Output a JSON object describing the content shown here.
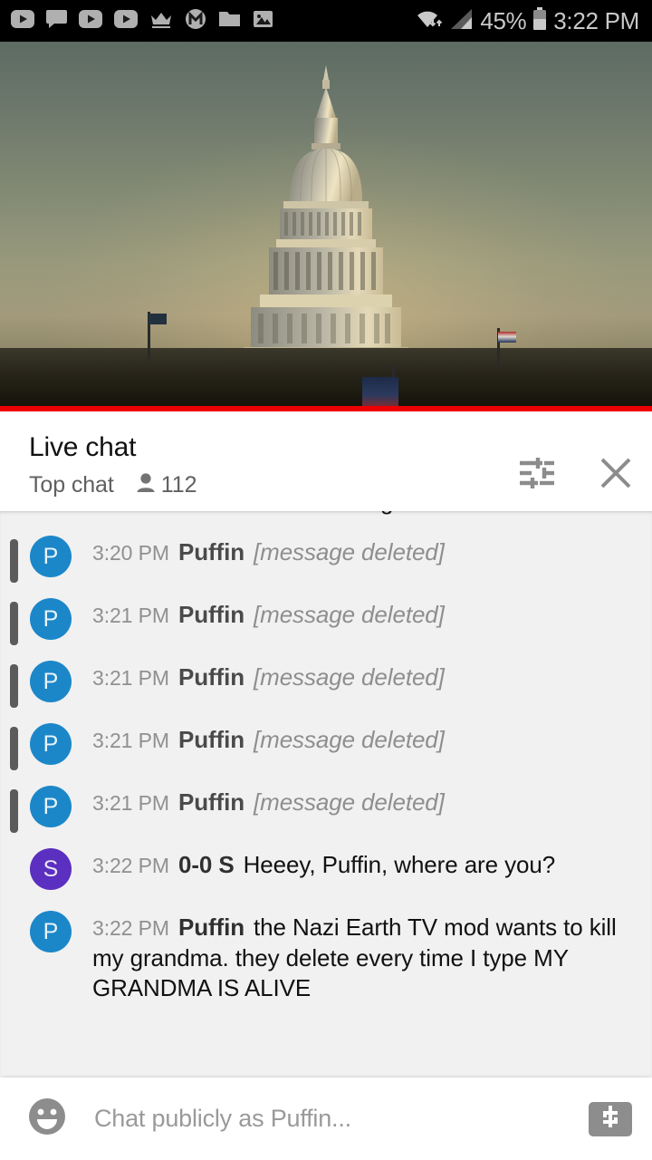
{
  "status_bar": {
    "left_icons": [
      {
        "name": "youtube-icon"
      },
      {
        "name": "chat-bubble-icon"
      },
      {
        "name": "youtube-icon"
      },
      {
        "name": "youtube-icon"
      },
      {
        "name": "crown-icon"
      },
      {
        "name": "m-circle-icon"
      },
      {
        "name": "folder-icon"
      },
      {
        "name": "image-icon"
      }
    ],
    "wifi_icon": "wifi-icon",
    "signal_icon": "signal-bars-icon",
    "battery_icon": "battery-icon",
    "battery_percent": "45%",
    "clock": "3:22 PM",
    "background_color": "#000000",
    "text_color": "#c9c9c9"
  },
  "video": {
    "name": "live-video-player",
    "description": "US Capitol dome at sunset",
    "progress_bar_color": "#ee0000",
    "progress_percent": 100
  },
  "chat_header": {
    "title": "Live chat",
    "mode": "Top chat",
    "viewers_icon": "person-icon",
    "viewers": "112",
    "settings_icon": "tune-icon",
    "close_icon": "close-icon"
  },
  "chat": {
    "background_color": "#f1f1f1",
    "partial_top_message": "g",
    "messages": [
      {
        "time": "3:20 PM",
        "author": "Puffin",
        "text": "[message deleted]",
        "deleted": true,
        "avatar_letter": "P",
        "avatar_color": "#1b87c9"
      },
      {
        "time": "3:21 PM",
        "author": "Puffin",
        "text": "[message deleted]",
        "deleted": true,
        "avatar_letter": "P",
        "avatar_color": "#1b87c9"
      },
      {
        "time": "3:21 PM",
        "author": "Puffin",
        "text": "[message deleted]",
        "deleted": true,
        "avatar_letter": "P",
        "avatar_color": "#1b87c9"
      },
      {
        "time": "3:21 PM",
        "author": "Puffin",
        "text": "[message deleted]",
        "deleted": true,
        "avatar_letter": "P",
        "avatar_color": "#1b87c9"
      },
      {
        "time": "3:21 PM",
        "author": "Puffin",
        "text": "[message deleted]",
        "deleted": true,
        "avatar_letter": "P",
        "avatar_color": "#1b87c9"
      },
      {
        "time": "3:22 PM",
        "author": "0-0 S",
        "text": "Heeey, Puffin, where are you?",
        "deleted": false,
        "avatar_letter": "S",
        "avatar_color": "#5b2fbf"
      },
      {
        "time": "3:22 PM",
        "author": "Puffin",
        "text": "the Nazi Earth TV mod wants to kill my grandma. they delete every time I type MY GRANDMA IS ALIVE",
        "deleted": false,
        "avatar_letter": "P",
        "avatar_color": "#1b87c9"
      }
    ]
  },
  "input_bar": {
    "emoji_icon": "emoji-smiley-icon",
    "placeholder": "Chat publicly as Puffin...",
    "value": "",
    "superchat_icon": "dollar-icon"
  }
}
